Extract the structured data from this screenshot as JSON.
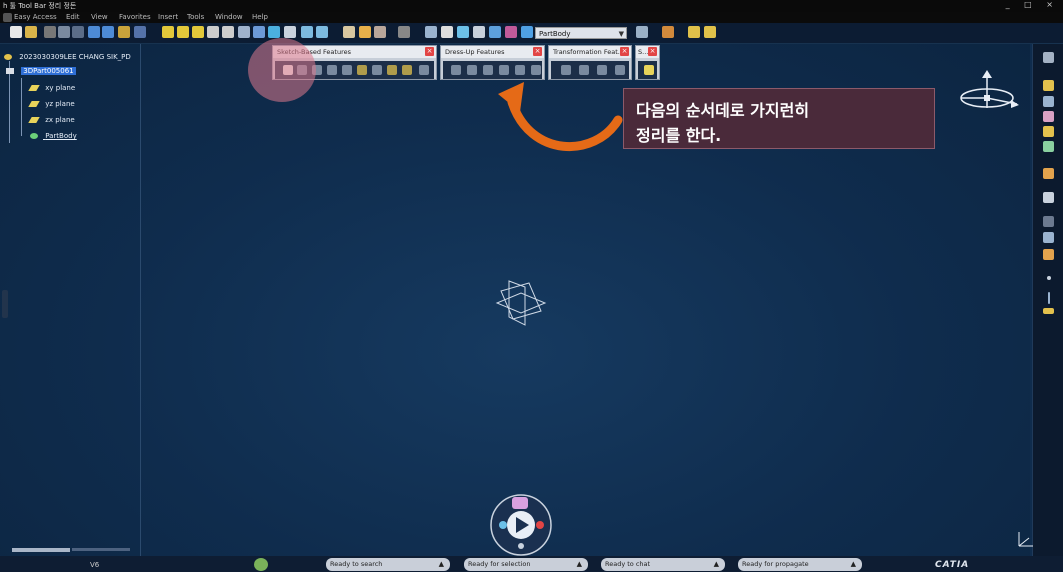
{
  "window": {
    "title": "h 툴 Tool Bar 정리 정돈",
    "controls": "_ □ ×"
  },
  "menu": [
    "Easy Access",
    "Edit",
    "View",
    "Favorites",
    "Insert",
    "Tools",
    "Window",
    "Help"
  ],
  "toolbar": {
    "current_body": "PartBody"
  },
  "tree": {
    "root": "2023030309LEE CHANG SIK_PD",
    "part": "3DPart005061",
    "items": [
      "xy plane",
      "yz plane",
      "zx plane",
      "PartBody"
    ]
  },
  "floating_toolbars": [
    {
      "title": "Sketch-Based Features",
      "close": "×"
    },
    {
      "title": "Dress-Up Features",
      "close": "×"
    },
    {
      "title": "Transformation Feat...",
      "close": "×"
    },
    {
      "title": "S...",
      "close": "×"
    }
  ],
  "callout": {
    "line1": "다음의 순서데로 가지런히",
    "line2": "정리를 한다."
  },
  "status": {
    "left_label": "V6",
    "search": "Ready to search",
    "selection": "Ready for selection",
    "chat": "Ready to chat",
    "propagate": "Ready for propagate",
    "brand": "CATIA"
  },
  "colors": {
    "background": "#0f2c4d",
    "highlight": "#dc788c",
    "arrow": "#e56a17",
    "callout_bg": "#4a2a3a",
    "selected": "#2f6fd6"
  }
}
